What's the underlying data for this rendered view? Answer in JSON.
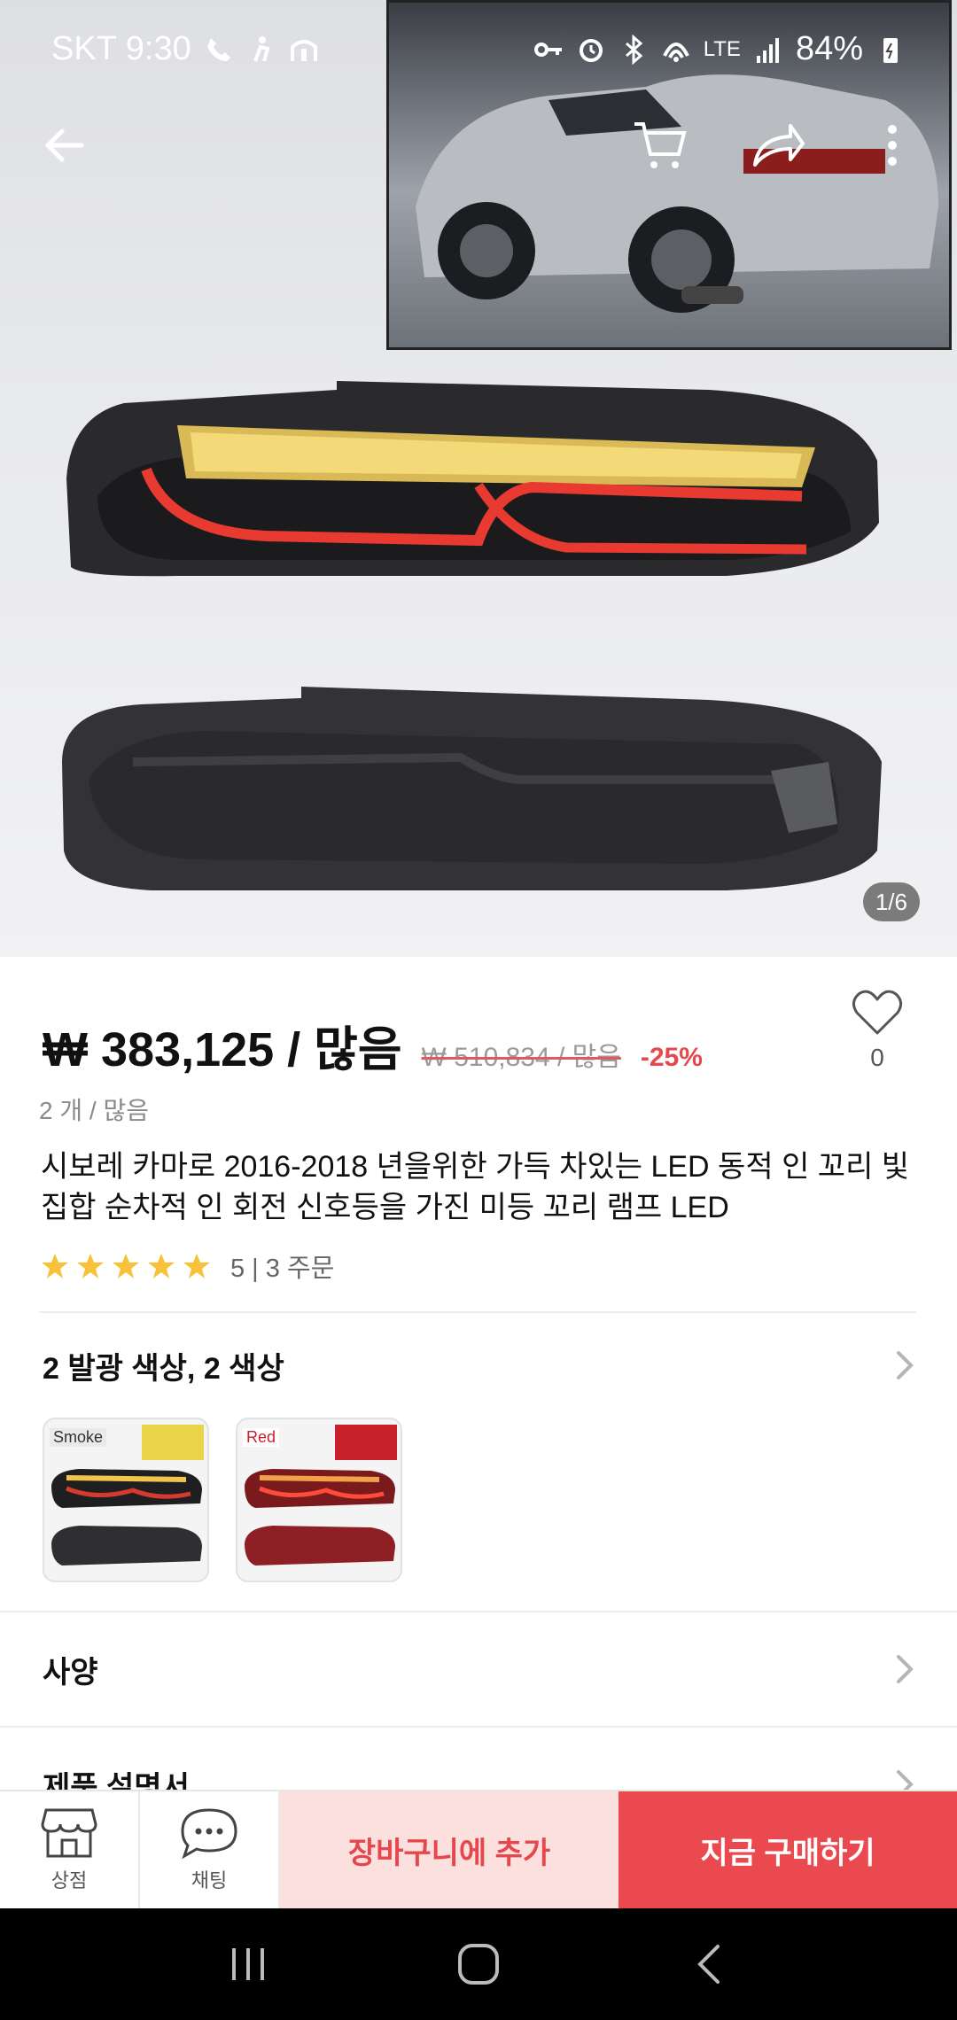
{
  "status_bar": {
    "carrier_time": "SKT 9:30",
    "network": "LTE",
    "battery": "84%"
  },
  "gallery": {
    "pager": "1/6",
    "inset_alt": "Chevrolet Camaro convertible rear view"
  },
  "product": {
    "price": "₩ 383,125 / 많음",
    "original_price": "₩ 510,834 / 많음",
    "discount": "-25%",
    "wishlist_count": "0",
    "quantity": "2 개 / 많음",
    "title": "시보레 카마로 2016-2018 년을위한 가득 차있는 LED 동적 인 꼬리 빛 집합 순차적 인 회전 신호등을 가진 미등 꼬리 램프 LED",
    "rating": 5,
    "rating_text": "5 | 3 주문"
  },
  "options": {
    "title": "2 발광 색상, 2 색상",
    "variants": [
      {
        "label": "Smoke",
        "color": "#222222"
      },
      {
        "label": "Red",
        "color": "#c9212b"
      }
    ]
  },
  "sections": {
    "specs": "사양",
    "manual": "제품 설명서"
  },
  "bottom_bar": {
    "store": "상점",
    "chat": "채팅",
    "add_to_cart": "장바구니에 추가",
    "buy_now": "지금 구매하기"
  },
  "colors": {
    "accent": "#ea4a4f",
    "accent_light": "#fbe0de",
    "star": "#f7c23a"
  }
}
